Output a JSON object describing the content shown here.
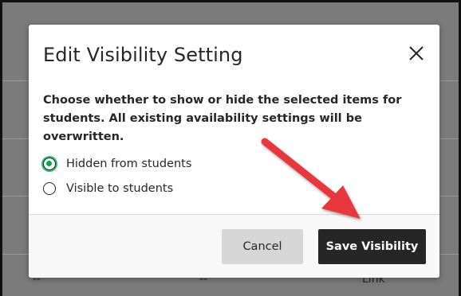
{
  "background_table": {
    "cells": [
      "--",
      "--",
      "Link"
    ]
  },
  "dialog": {
    "title": "Edit Visibility Setting",
    "close_icon": "close-icon",
    "instruction": "Choose whether to show or hide the selected items for students. All existing availability settings will be overwritten.",
    "options": [
      {
        "label": "Hidden from students",
        "selected": true
      },
      {
        "label": "Visible to students",
        "selected": false
      }
    ],
    "buttons": {
      "cancel_label": "Cancel",
      "save_label": "Save Visibility"
    }
  },
  "annotation": {
    "arrow_icon": "red-arrow-icon",
    "color": "#e8393e"
  }
}
